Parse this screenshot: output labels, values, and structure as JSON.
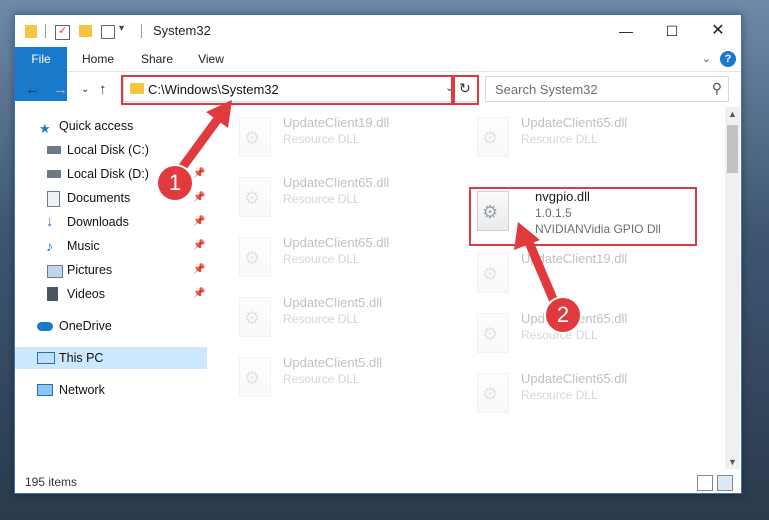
{
  "window": {
    "title": "System32"
  },
  "ribbon": {
    "tabs": [
      "File",
      "Home",
      "Share",
      "View"
    ]
  },
  "address": {
    "path": "C:\\Windows\\System32"
  },
  "search": {
    "placeholder": "Search System32"
  },
  "sidebar": {
    "items": [
      {
        "label": "Quick access",
        "icon": "star-icon"
      },
      {
        "label": "Local Disk (C:)",
        "icon": "drive-icon"
      },
      {
        "label": "Local Disk (D:)",
        "icon": "drive-icon"
      },
      {
        "label": "Documents",
        "icon": "documents-icon"
      },
      {
        "label": "Downloads",
        "icon": "download-icon"
      },
      {
        "label": "Music",
        "icon": "music-icon"
      },
      {
        "label": "Pictures",
        "icon": "pictures-icon"
      },
      {
        "label": "Videos",
        "icon": "videos-icon"
      },
      {
        "label": "OneDrive",
        "icon": "cloud-icon"
      },
      {
        "label": "This PC",
        "icon": "computer-icon"
      },
      {
        "label": "Network",
        "icon": "network-icon"
      }
    ]
  },
  "files": [
    {
      "name": "UpdateClient19.dll",
      "desc": "Resource DLL"
    },
    {
      "name": "UpdateClient65.dll",
      "desc": "Resource DLL"
    },
    {
      "name": "UpdateClient65.dll",
      "desc": "Resource DLL"
    },
    {
      "name": "nvgpio.dll",
      "version": "1.0.1.5",
      "desc": "NVIDIANVidia GPIO Dll"
    },
    {
      "name": "UpdateClient65.dll",
      "desc": "Resource DLL"
    },
    {
      "name": "UpdateClient19.dll",
      "desc": "Resource DLL"
    },
    {
      "name": "UpdateClient5.dll",
      "desc": "Resource DLL"
    },
    {
      "name": "UpdateClient65.dll",
      "desc": "Resource DLL"
    },
    {
      "name": "UpdateClient5.dll",
      "desc": "Resource DLL"
    },
    {
      "name": "UpdateClient65.dll",
      "desc": "Resource DLL"
    }
  ],
  "status": {
    "items": "195 items"
  },
  "annotations": {
    "step1": "1",
    "step2": "2",
    "color": "#e0393e"
  }
}
